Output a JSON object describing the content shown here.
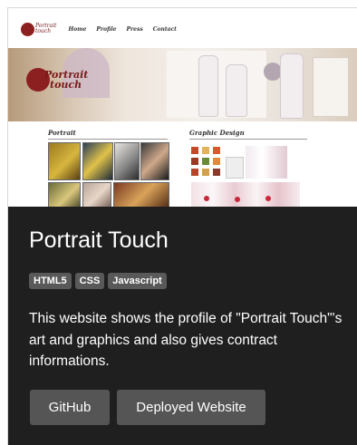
{
  "preview": {
    "logo_line1": "Portrait",
    "logo_line2": "touch",
    "nav": [
      "Home",
      "Profile",
      "Press",
      "Contact"
    ],
    "banner_logo_line1": "Portrait",
    "banner_logo_line2": "touch",
    "portrait_heading": "Portrait",
    "graphic_heading": "Graphic Design"
  },
  "card": {
    "title": "Portrait Touch",
    "tags": [
      "HTML5",
      "CSS",
      "Javascript"
    ],
    "description": "This website shows the profile of \"Portrait Touch\"'s art and graphics and also gives contract informations.",
    "buttons": {
      "github": "GitHub",
      "website": "Deployed Website"
    }
  }
}
